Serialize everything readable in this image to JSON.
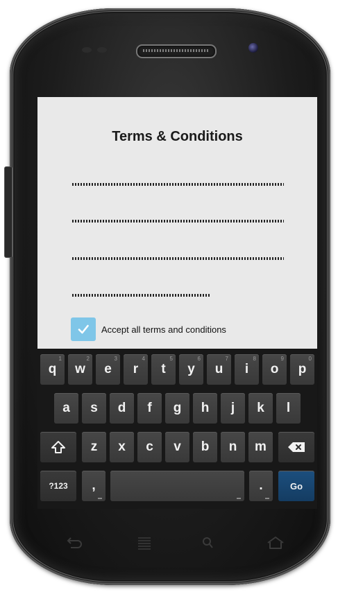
{
  "screen": {
    "title": "Terms & Conditions",
    "checkbox": {
      "label": "Accept all terms and conditions",
      "checked": true
    }
  },
  "keyboard": {
    "row1": [
      {
        "label": "q",
        "hint": "1"
      },
      {
        "label": "w",
        "hint": "2"
      },
      {
        "label": "e",
        "hint": "3"
      },
      {
        "label": "r",
        "hint": "4"
      },
      {
        "label": "t",
        "hint": "5"
      },
      {
        "label": "y",
        "hint": "6"
      },
      {
        "label": "u",
        "hint": "7"
      },
      {
        "label": "i",
        "hint": "8"
      },
      {
        "label": "o",
        "hint": "9"
      },
      {
        "label": "p",
        "hint": "0"
      }
    ],
    "row2": [
      "a",
      "s",
      "d",
      "f",
      "g",
      "h",
      "j",
      "k",
      "l"
    ],
    "row3": [
      "z",
      "x",
      "c",
      "v",
      "b",
      "n",
      "m"
    ],
    "symbols_label": "?123",
    "comma_label": ",",
    "period_label": ".",
    "go_label": "Go"
  },
  "colors": {
    "screen_bg": "#e9e9e9",
    "checkbox": "#7fc6e8",
    "go_key": "#1c4f7e",
    "key": "#444444"
  },
  "icons": {
    "shift": "shift-icon",
    "backspace": "backspace-icon",
    "back": "back-icon",
    "home": "home-icon",
    "menu": "menu-icon",
    "search": "search-icon"
  }
}
